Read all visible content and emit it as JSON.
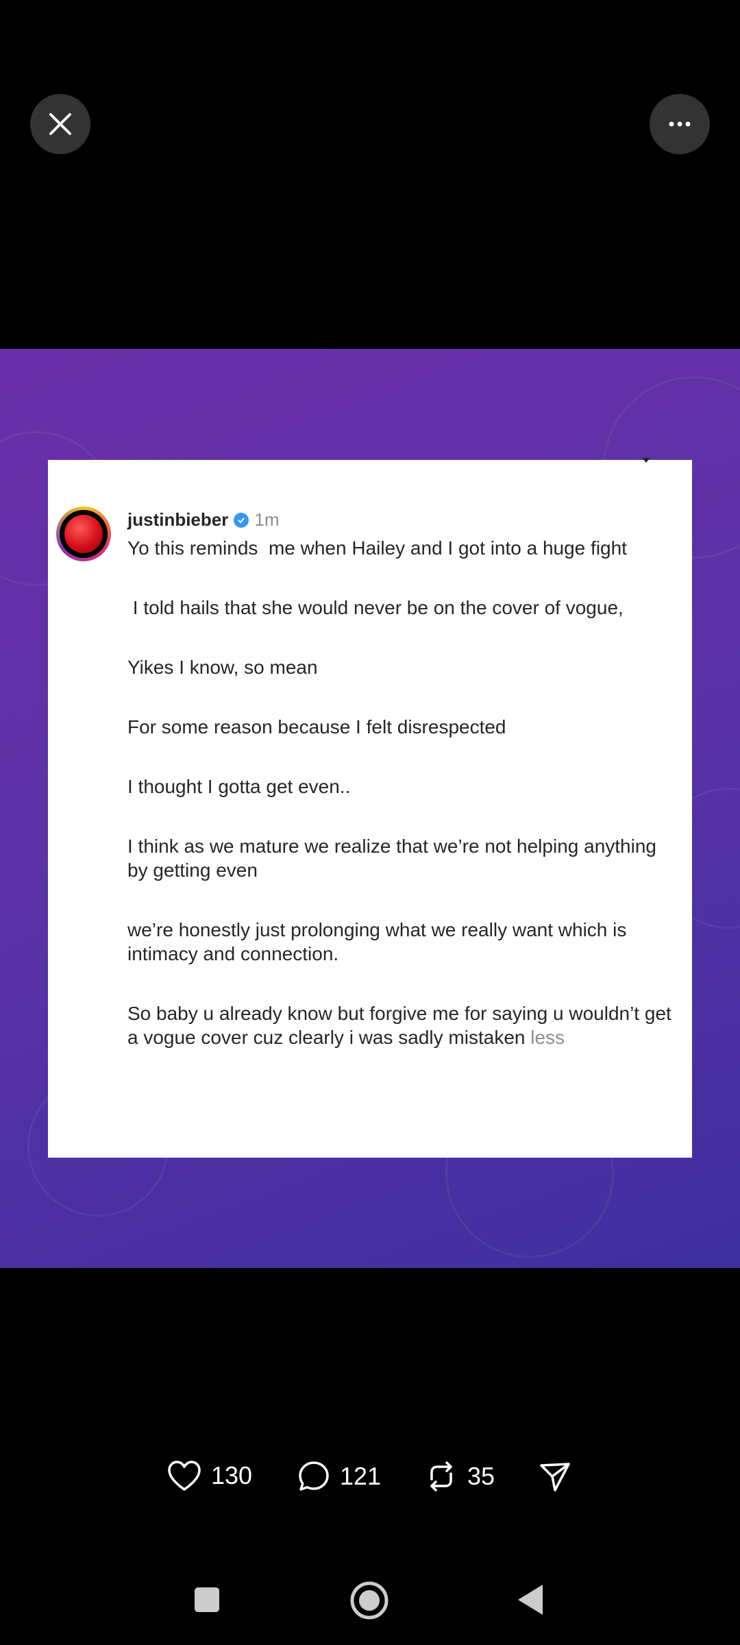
{
  "post": {
    "username": "justinbieber",
    "time": "1m",
    "paragraphs": [
      "Yo this reminds  me when Hailey and I got into a huge fight",
      " I told hails that she would never be on the cover of vogue,",
      "Yikes I know, so mean",
      "For some reason because I felt disrespected",
      "I thought I gotta get even..",
      "I think as we mature we realize that we’re not helping anything by getting even",
      "we’re honestly just prolonging what we really want which is intimacy and connection.",
      "So baby u already know but forgive me for saying u wouldn’t get a vogue cover cuz clearly i was sadly mistaken"
    ],
    "less_label": "less"
  },
  "actions": {
    "likes": "130",
    "comments": "121",
    "reposts": "35"
  },
  "icons": {
    "close": "close-icon",
    "more": "more-icon",
    "like": "heart-icon",
    "comment": "comment-icon",
    "repost": "repost-icon",
    "share": "send-icon"
  },
  "colors": {
    "gradient_start": "#6a2fa8",
    "gradient_end": "#3f2fa0",
    "verified": "#3897f0"
  }
}
